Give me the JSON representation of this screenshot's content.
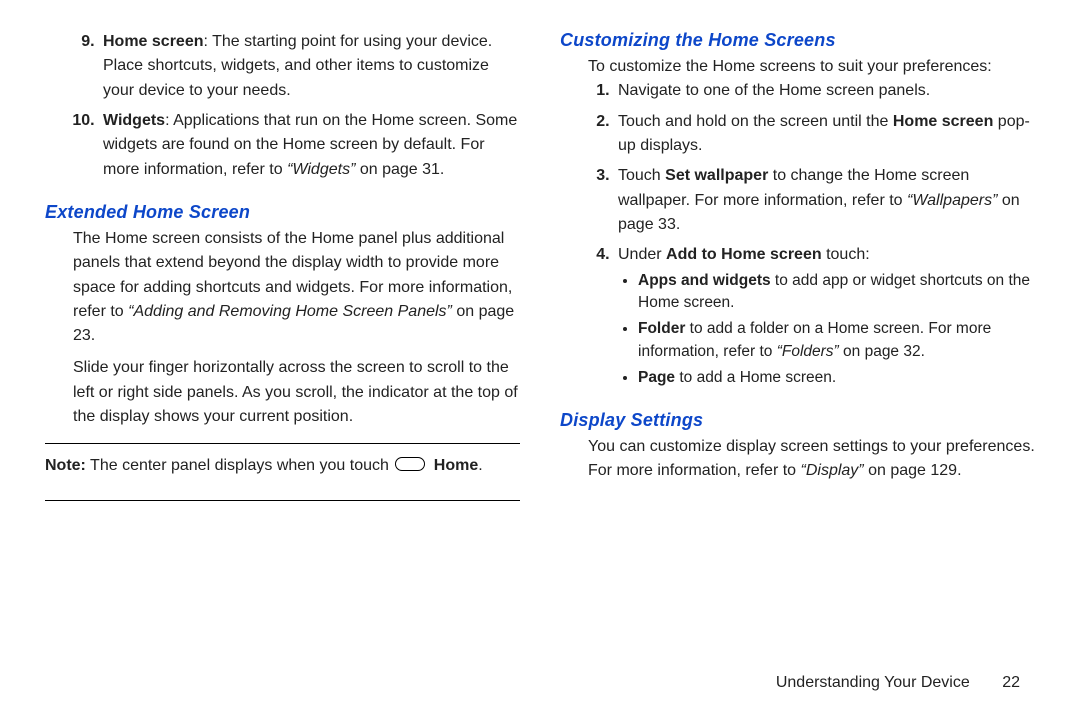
{
  "left": {
    "items": [
      {
        "num": "9.",
        "lead": "Home screen",
        "text": ": The starting point for using your device. Place shortcuts, widgets, and other items to customize your device to your needs."
      },
      {
        "num": "10.",
        "lead": "Widgets",
        "text": ": Applications that run on the Home screen. Some widgets are found on the Home screen by default. For more information, refer to ",
        "ref": "“Widgets”",
        "tail": " on page 31."
      }
    ],
    "h1": "Extended Home Screen",
    "p1a": "The Home screen consists of the Home panel plus additional panels that extend beyond the display width to provide more space for adding shortcuts and widgets. For more information, refer to ",
    "p1ref": "“Adding and Removing Home Screen Panels”",
    "p1b": " on page 23.",
    "p2": "Slide your finger horizontally across the screen to scroll to the left or right side panels. As you scroll, the indicator at the top of the display shows your current position.",
    "note_label": "Note:",
    "note_text": " The center panel displays when you touch ",
    "note_bold": "Home",
    "note_period": "."
  },
  "right": {
    "h1": "Customizing the Home Screens",
    "intro": "To customize the Home screens to suit your preferences:",
    "step1": "Navigate to one of the Home screen panels.",
    "step2a": "Touch and hold on the screen until the ",
    "step2bold": "Home screen",
    "step2b": " pop-up displays.",
    "step3a": "Touch ",
    "step3bold": "Set wallpaper",
    "step3b": " to change the Home screen wallpaper. For more information, refer to ",
    "step3ref": "“Wallpapers”",
    "step3c": " on page 33.",
    "step4a": "Under ",
    "step4bold": "Add to Home screen",
    "step4b": " touch:",
    "b1lead": "Apps and widgets",
    "b1text": " to add app or widget shortcuts on the Home screen.",
    "b2lead": "Folder",
    "b2text": " to add a folder on a Home screen. For more information, refer to ",
    "b2ref": "“Folders”",
    "b2tail": " on page 32.",
    "b3lead": "Page",
    "b3text": " to add a Home screen.",
    "h2": "Display Settings",
    "ds_a": "You can customize display screen settings to your preferences. For more information, refer to ",
    "ds_ref": "“Display”",
    "ds_b": " on page 129."
  },
  "footer": {
    "section": "Understanding Your Device",
    "page": "22"
  }
}
